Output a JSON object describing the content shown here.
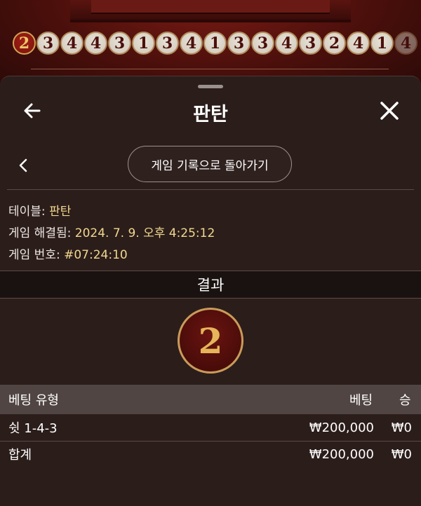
{
  "roads": [
    "2",
    "3",
    "4",
    "4",
    "3",
    "1",
    "3",
    "4",
    "1",
    "3",
    "3",
    "4",
    "3",
    "2",
    "4",
    "1",
    "4"
  ],
  "header": {
    "title": "판탄"
  },
  "nav": {
    "back_to_history": "게임 기록으로 돌아가기"
  },
  "info": {
    "table_label": "테이블:",
    "table_value": "판탄",
    "resolved_label": "게임 해결됨:",
    "resolved_value": "2024. 7. 9. 오후 4:25:12",
    "game_no_label": "게임 번호:",
    "game_no_value": "#07:24:10"
  },
  "result": {
    "label": "결과",
    "value": "2"
  },
  "bets": {
    "headers": {
      "type": "베팅 유형",
      "bet": "베팅",
      "win": "승"
    },
    "rows": [
      {
        "type": "쉿 1-4-3",
        "bet": "₩200,000",
        "win": "₩0"
      }
    ],
    "total": {
      "label": "합계",
      "bet": "₩200,000",
      "win": "₩0"
    }
  },
  "colors": {
    "accent_gold": "#f2d890",
    "brand_red": "#7a130d"
  }
}
